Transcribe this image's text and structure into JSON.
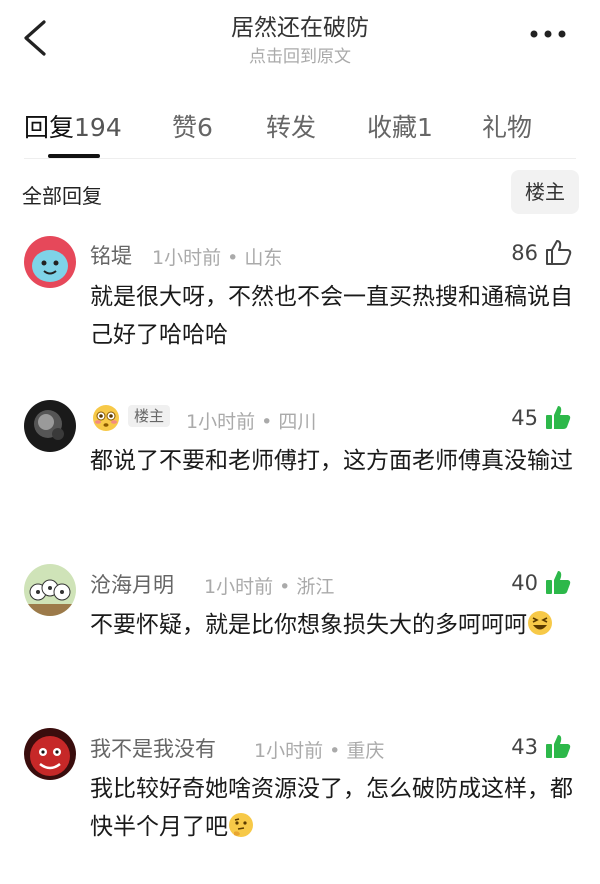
{
  "header": {
    "title": "居然还在破防",
    "subtitle": "点击回到原文"
  },
  "tabs": [
    {
      "label": "回复",
      "count": "194"
    },
    {
      "label": "赞",
      "count": "6"
    },
    {
      "label": "转发",
      "count": ""
    },
    {
      "label": "收藏",
      "count": "1"
    },
    {
      "label": "礼物",
      "count": ""
    }
  ],
  "filter": {
    "all_label": "全部回复",
    "op_label": "楼主"
  },
  "comments": [
    {
      "user": "铭堤",
      "time": "1小时前",
      "location": "山东",
      "likes": "86",
      "liked": false,
      "text": "就是很大呀，不然也不会一直买热搜和通稿说自己好了哈哈哈"
    },
    {
      "user": "",
      "op_tag": "楼主",
      "time": "1小时前",
      "location": "四川",
      "likes": "45",
      "liked": true,
      "text": "都说了不要和老师傅打，这方面老师傅真没输过"
    },
    {
      "user": "沧海月明",
      "time": "1小时前",
      "location": "浙江",
      "likes": "40",
      "liked": true,
      "text": "不要怀疑，就是比你想象损失大的多呵呵呵"
    },
    {
      "user": "我不是我没有",
      "time": "1小时前",
      "location": "重庆",
      "likes": "43",
      "liked": true,
      "text": "我比较好奇她啥资源没了，怎么破防成这样，都快半个月了吧"
    }
  ],
  "colors": {
    "like_active": "#2db84a",
    "text_primary": "#1a1a1a",
    "text_secondary": "#aaaaaa"
  },
  "icons": [
    "back-arrow-icon",
    "more-dots-icon",
    "thumbs-up-outline-icon",
    "thumbs-up-filled-icon",
    "flushed-emoji-icon",
    "laughing-emoji-icon",
    "thinking-emoji-icon"
  ]
}
